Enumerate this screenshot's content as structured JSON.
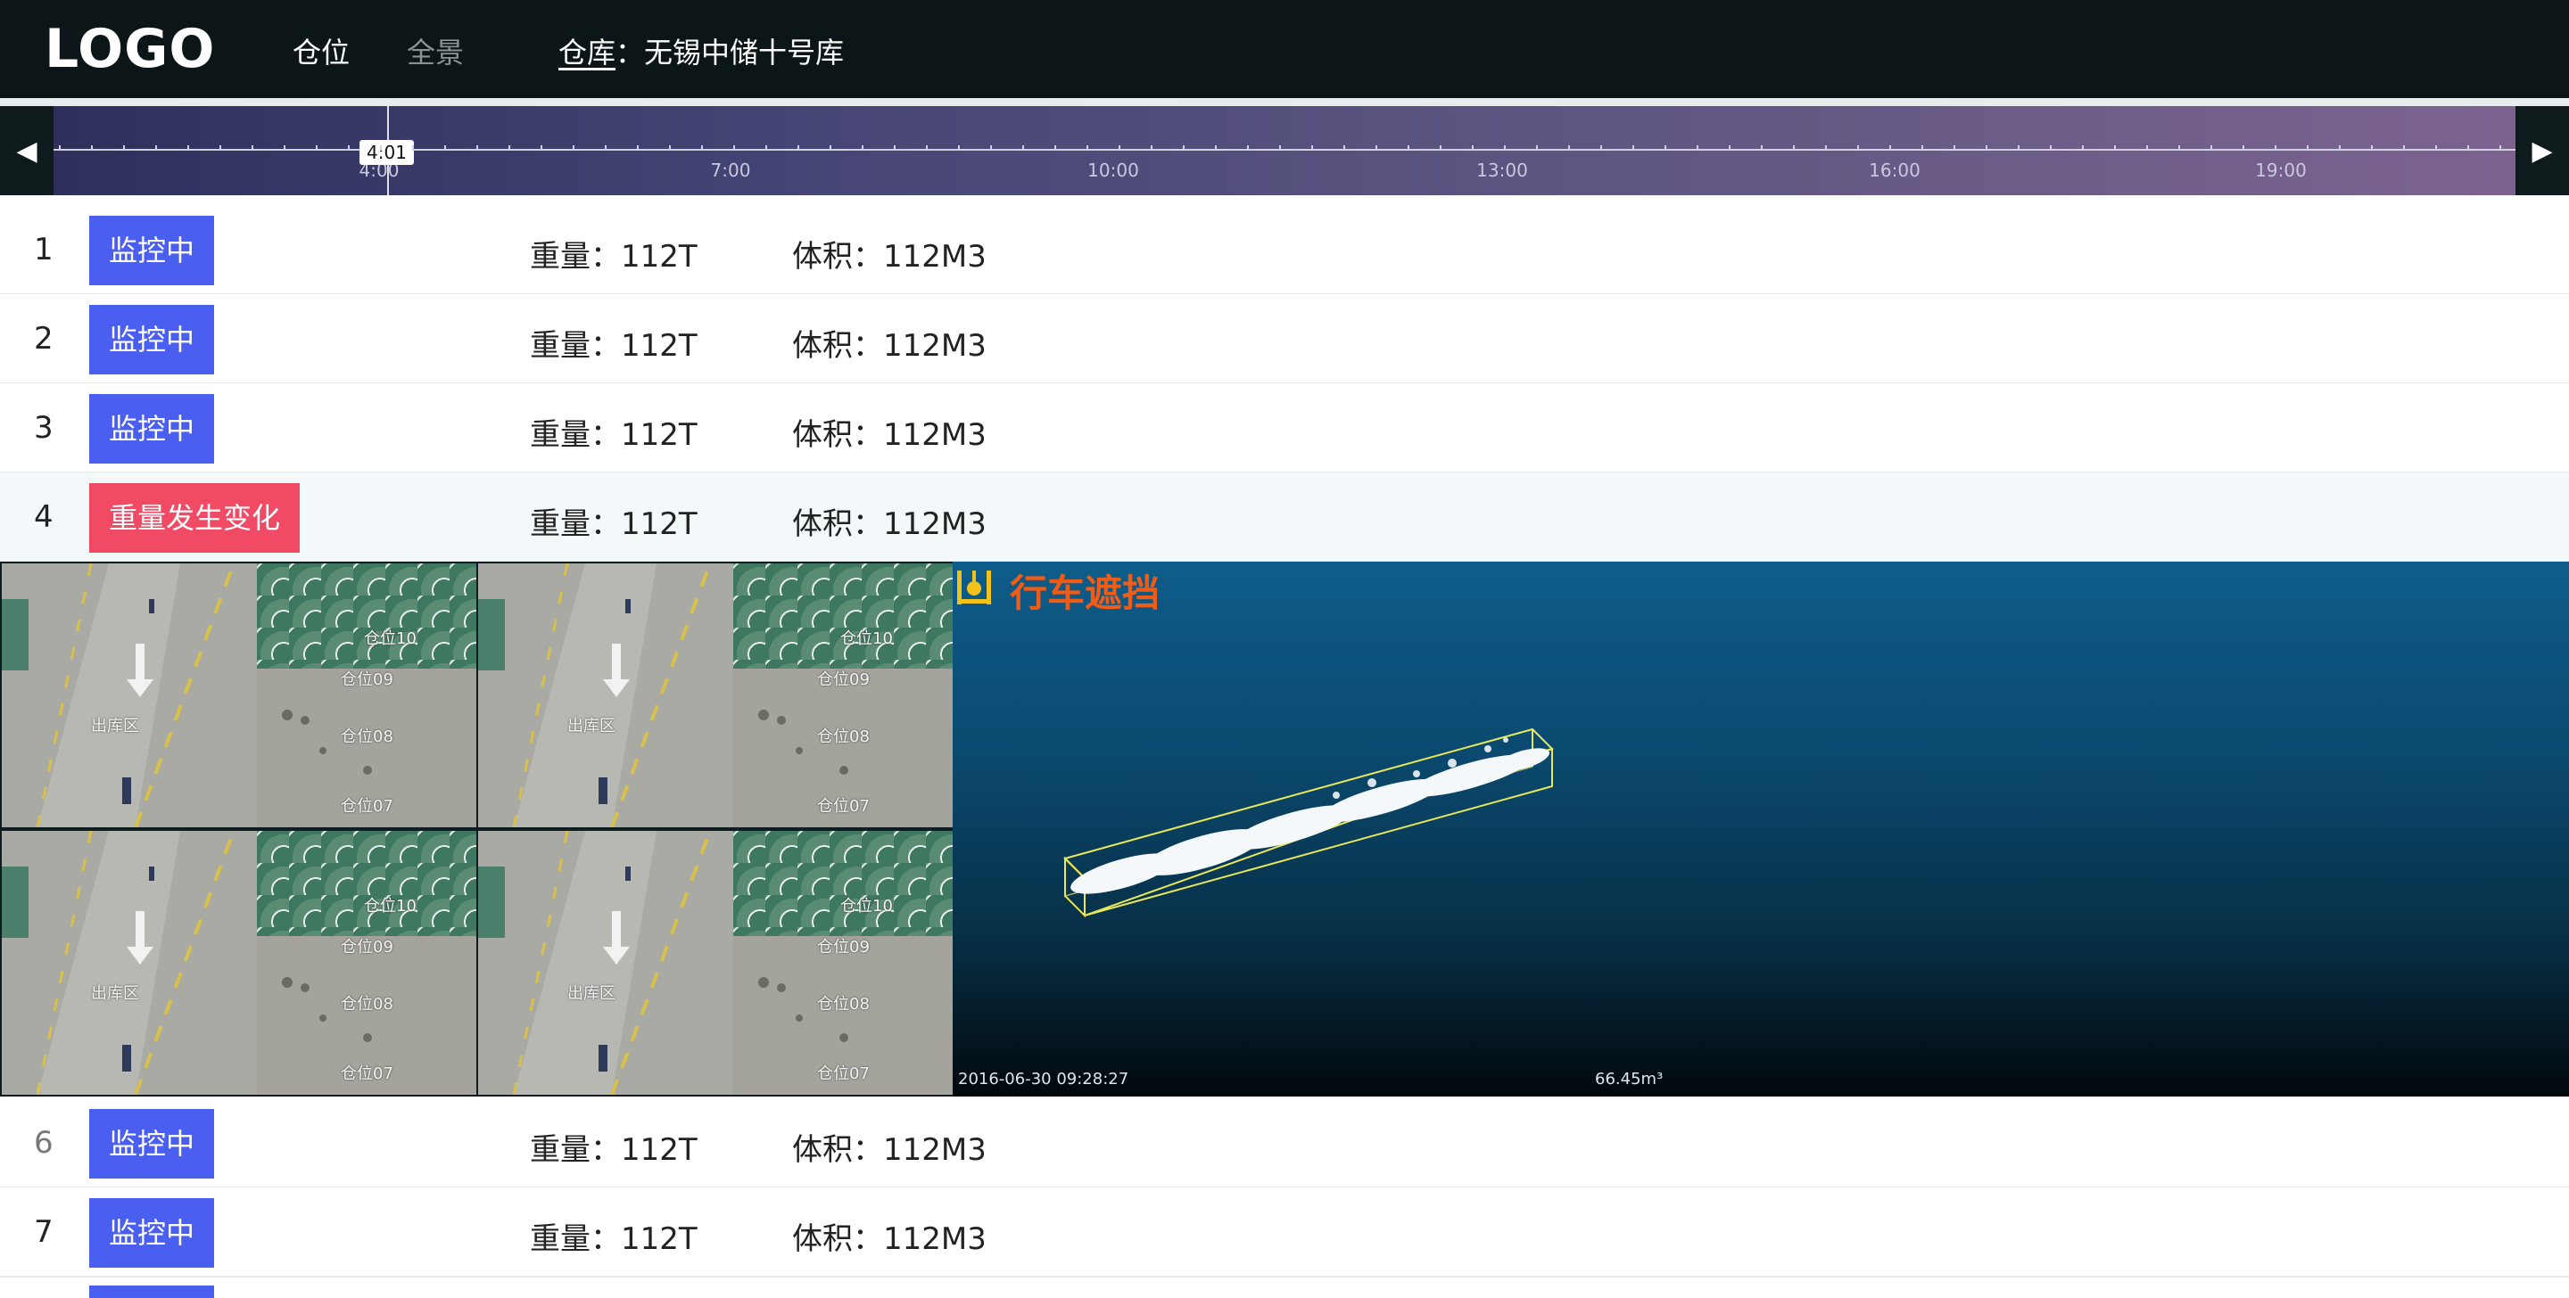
{
  "header": {
    "logo": "LOGO",
    "nav": [
      {
        "label": "仓位",
        "active": true
      },
      {
        "label": "全景",
        "active": false
      }
    ],
    "warehouse_label": "仓库",
    "warehouse_name": "：无锡中储十号库"
  },
  "timeline": {
    "prev_icon": "◀",
    "next_icon": "▶",
    "hour_labels": [
      "4:00",
      "7:00",
      "10:00",
      "13:00",
      "16:00",
      "19:00"
    ],
    "current_time": "4:01"
  },
  "rows": [
    {
      "number": "1",
      "status": "监控中",
      "status_type": "ok",
      "weight": "重量：112T",
      "volume": "体积：112M3"
    },
    {
      "number": "2",
      "status": "监控中",
      "status_type": "ok",
      "weight": "重量：112T",
      "volume": "体积：112M3"
    },
    {
      "number": "3",
      "status": "监控中",
      "status_type": "ok",
      "weight": "重量：112T",
      "volume": "体积：112M3"
    },
    {
      "number": "4",
      "status": "重量发生变化",
      "status_type": "alert",
      "weight": "重量：112T",
      "volume": "体积：112M3"
    },
    {
      "number": "6",
      "status": "监控中",
      "status_type": "ok",
      "weight": "重量：112T",
      "volume": "体积：112M3"
    },
    {
      "number": "7",
      "status": "监控中",
      "status_type": "ok",
      "weight": "重量：112T",
      "volume": "体积：112M3"
    }
  ],
  "detail": {
    "camera_labels": [
      "仓位10",
      "仓位09",
      "仓位08",
      "仓位07",
      "出库区"
    ],
    "pointcloud_title": "行车遮挡",
    "pointcloud_icon": "crane-icon",
    "timestamp": "2016-06-30 09:28:27",
    "volume": "66.45m³"
  },
  "colors": {
    "topbar_bg": "#0c1618",
    "status_ok": "#4a5ef0",
    "status_alert": "#f04a65",
    "alert_title": "#f05b16"
  }
}
